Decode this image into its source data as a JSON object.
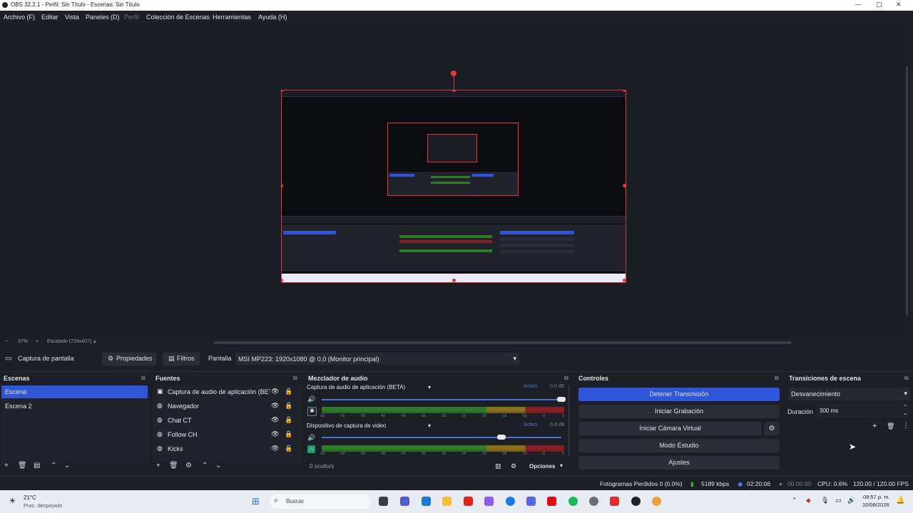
{
  "window": {
    "title": "OBS 32.2.1 - Perfil: Sin Título - Escenas: Sin Título"
  },
  "menu": [
    "Archivo (F)",
    "Editar",
    "Vista",
    "Paneles (D)",
    "Perfil",
    "Colección de Escenas",
    "Herramientas",
    "Ayuda (H)"
  ],
  "preview": {
    "zoom": "37%",
    "scale_label": "Escalado (724x407)"
  },
  "source_toolbar": {
    "source_name": "Captura de pantalla",
    "properties": "Propiedades",
    "filters": "Filtros",
    "display_label": "Pantalla",
    "display_value": "MSI MP223: 1920x1080 @ 0,0 (Monitor principal)"
  },
  "scenes": {
    "title": "Escenas",
    "items": [
      "Escena",
      "Escena 2"
    ],
    "selected": 0
  },
  "sources": {
    "title": "Fuentes",
    "items": [
      "Captura de audio de aplicación (BET",
      "Navegador",
      "Chat CT",
      "Follow CH",
      "Kicks"
    ]
  },
  "mixer": {
    "title": "Mezclador de audio",
    "channels": [
      {
        "name": "Captura de audio de aplicación (BETA)",
        "status": "Activo",
        "db": "0.0 dB",
        "level": 1.0
      },
      {
        "name": "Dispositivo de captura de video",
        "status": "Activo",
        "db": "-5.8 dB",
        "level": 0.75
      }
    ],
    "ticks": [
      "-60",
      "-55",
      "-50",
      "-45",
      "-40",
      "-35",
      "-30",
      "-25",
      "-20",
      "-15",
      "-10",
      "-5",
      "0"
    ],
    "hidden": "0 oculto/s",
    "options": "Opciones"
  },
  "controls": {
    "title": "Controles",
    "stop_stream": "Detener Transmisión",
    "start_record": "Iniciar Grabación",
    "virtual_cam": "Iniciar Cámara Virtual",
    "studio_mode": "Modo Estudio",
    "settings": "Ajustes"
  },
  "transitions": {
    "title": "Transiciones de escena",
    "selected": "Desvanecimiento",
    "duration_label": "Duración",
    "duration_value": "300 ms"
  },
  "status": {
    "dropped": "Fotogramas Perdidos 0 (0.0%)",
    "bitrate": "5189 kbps",
    "stream_time": "02:20:06",
    "rec_time": "00:00:00",
    "cpu": "CPU: 0.6%",
    "fps": "120.00 / 120.00 FPS"
  },
  "taskbar": {
    "weather_temp": "21°C",
    "weather_desc": "Prac. despejado",
    "search": "Buscar",
    "time": "08:57 p. m.",
    "date": "10/08/2026"
  },
  "colors": {
    "accent": "#2f56d9",
    "selection_red": "#e8343e",
    "bg": "#1d1f26"
  }
}
